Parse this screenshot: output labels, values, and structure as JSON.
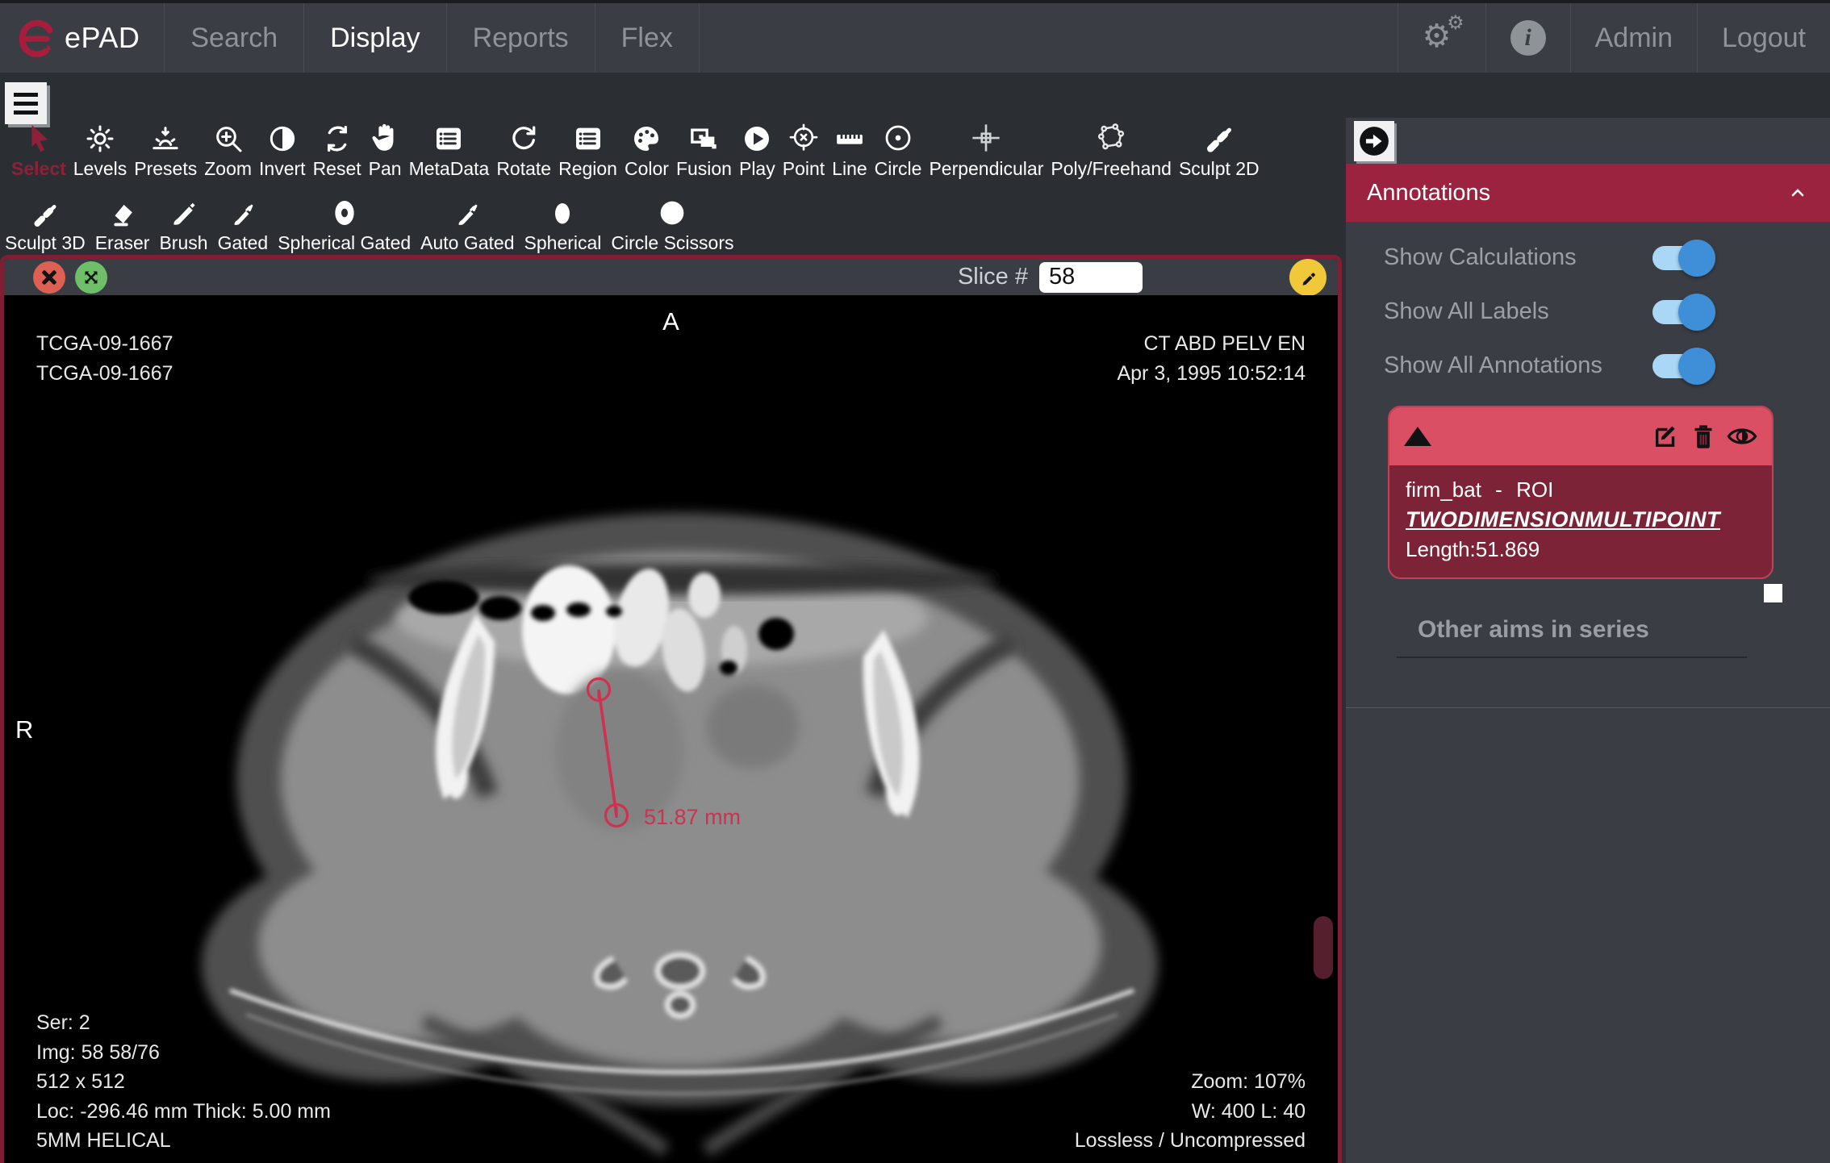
{
  "navbar": {
    "brand": "ePAD",
    "tabs": [
      {
        "label": "Search",
        "active": false
      },
      {
        "label": "Display",
        "active": true
      },
      {
        "label": "Reports",
        "active": false
      },
      {
        "label": "Flex",
        "active": false
      }
    ],
    "settings_icon": "cogs-icon",
    "info_icon": "info-circle-icon",
    "admin_label": "Admin",
    "logout_label": "Logout"
  },
  "toolbar": {
    "menu_icon": "hamburger-icon",
    "row1": [
      {
        "label": "Select",
        "icon": "cursor-icon",
        "active": true
      },
      {
        "label": "Levels",
        "icon": "sun-icon"
      },
      {
        "label": "Presets",
        "icon": "sunrise-icon"
      },
      {
        "label": "Zoom",
        "icon": "magnifier-plus-icon"
      },
      {
        "label": "Invert",
        "icon": "half-circle-icon"
      },
      {
        "label": "Reset",
        "icon": "circular-arrows-icon"
      },
      {
        "label": "Pan",
        "icon": "hand-icon"
      },
      {
        "label": "MetaData",
        "icon": "list-icon"
      },
      {
        "label": "Rotate",
        "icon": "rotate-arrow-icon"
      },
      {
        "label": "Region",
        "icon": "list-icon"
      },
      {
        "label": "Color",
        "icon": "palette-icon"
      },
      {
        "label": "Fusion",
        "icon": "overlap-frames-icon"
      },
      {
        "label": "Play",
        "icon": "play-circle-icon"
      },
      {
        "label": "Point",
        "icon": "crosshair-target-icon"
      },
      {
        "label": "Line",
        "icon": "ruler-icon"
      },
      {
        "label": "Circle",
        "icon": "circle-dot-icon"
      },
      {
        "label": "Perpendicular",
        "icon": "perpendicular-cross-icon"
      },
      {
        "label": "Poly/Freehand",
        "icon": "polygon-icon"
      },
      {
        "label": "Sculpt 2D",
        "icon": "pen-diagonal-icon"
      }
    ],
    "row2": [
      {
        "label": "Sculpt 3D",
        "icon": "pen-diagonal-icon"
      },
      {
        "label": "Eraser",
        "icon": "eraser-icon"
      },
      {
        "label": "Brush",
        "icon": "brush-icon"
      },
      {
        "label": "Gated",
        "icon": "small-brush-icon"
      },
      {
        "label": "Spherical Gated",
        "icon": "donut-icon"
      },
      {
        "label": "Auto Gated",
        "icon": "small-brush-icon"
      },
      {
        "label": "Spherical",
        "icon": "egg-icon"
      },
      {
        "label": "Circle Scissors",
        "icon": "filled-circle-icon"
      }
    ]
  },
  "viewer": {
    "close_icon": "close-x-icon",
    "expand_icon": "expand-arrows-icon",
    "slice_label": "Slice #",
    "slice_value": "58",
    "edit_slice_icon": "pencil-icon",
    "orientation_top": "A",
    "orientation_left": "R",
    "patient_line1": "TCGA-09-1667",
    "patient_line2": "TCGA-09-1667",
    "study_name": "CT ABD PELV EN",
    "study_datetime": "Apr 3, 1995 10:52:14",
    "measurement_label": "51.87 mm",
    "info_bottom_left": [
      "Ser: 2",
      "Img: 58 58/76",
      "512 x 512",
      "Loc: -296.46 mm Thick: 5.00 mm",
      "5MM HELICAL"
    ],
    "info_bottom_right": [
      "Zoom: 107%",
      "W: 400 L: 40",
      "Lossless / Uncompressed"
    ]
  },
  "annotations_panel": {
    "collapse_icon": "arrow-right-circle-icon",
    "title": "Annotations",
    "collapse_chevron": "chevron-up-icon",
    "toggles": [
      {
        "label": "Show Calculations",
        "on": true
      },
      {
        "label": "Show All Labels",
        "on": true
      },
      {
        "label": "Show All Annotations",
        "on": true
      }
    ],
    "annotation_card": {
      "expand_icon": "triangle-up-icon",
      "edit_icon": "edit-pencil-square-icon",
      "delete_icon": "trash-icon",
      "visibility_icon": "eye-icon",
      "name": "firm_bat",
      "separator": "-",
      "type": "ROI",
      "shape": "TWODIMENSIONMULTIPOINT",
      "length_text": "Length:51.869"
    },
    "other_aims_label": "Other aims in series"
  },
  "colors": {
    "navbar_bg": "#3a3e44",
    "toolbar_bg": "#2b2f33",
    "accent_maroon": "#9c2340",
    "viewer_border": "#7e1f33",
    "card_header": "#da4f63",
    "card_body": "#7c2337",
    "measurement": "#cf3150",
    "toggle_on": "#3f8fd8",
    "toggle_track": "#a9d7f5",
    "slice_edit_yellow": "#f0c83a",
    "close_red": "#dd6055",
    "expand_green": "#6fbf68"
  }
}
